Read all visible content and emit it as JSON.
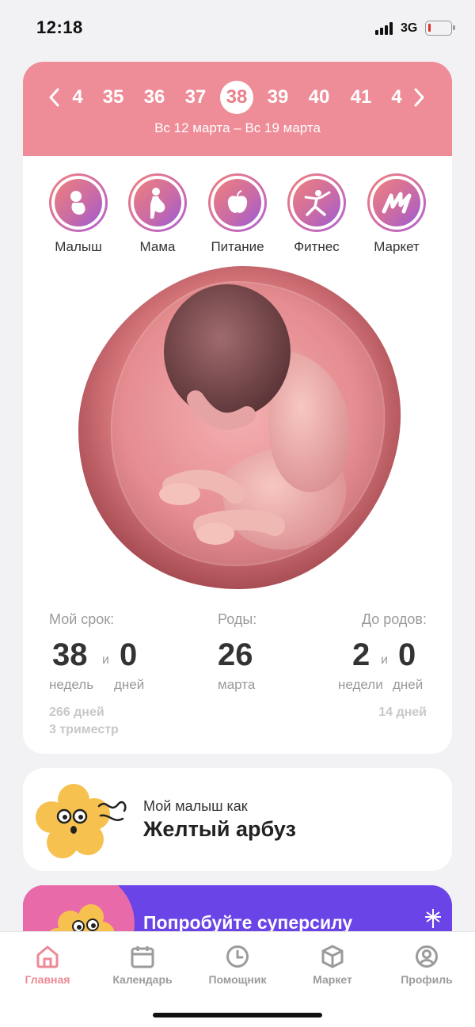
{
  "status": {
    "time": "12:18",
    "network": "3G"
  },
  "weeks": {
    "items": [
      "4",
      "35",
      "36",
      "37",
      "38",
      "39",
      "40",
      "41",
      "4"
    ],
    "active": "38",
    "range": "Вс 12 марта – Вс 19 марта",
    "prev_icon": "chevron-left-icon",
    "next_icon": "chevron-right-icon"
  },
  "categories": [
    {
      "label": "Малыш",
      "icon": "baby-icon"
    },
    {
      "label": "Мама",
      "icon": "pregnant-woman-icon"
    },
    {
      "label": "Питание",
      "icon": "apple-icon"
    },
    {
      "label": "Фитнес",
      "icon": "yoga-icon"
    },
    {
      "label": "Маркет",
      "icon": "market-logo-icon"
    }
  ],
  "term": {
    "my_term_label": "Мой срок:",
    "weeks_value": "38",
    "and": "и",
    "days_value": "0",
    "weeks_unit": "недель",
    "days_unit": "дней",
    "total_days": "266 дней",
    "trimester": "3 триместр",
    "birth_label": "Роды:",
    "birth_day": "26",
    "birth_month": "марта",
    "until_label": "До родов:",
    "until_weeks": "2",
    "until_days": "0",
    "until_weeks_unit": "недели",
    "until_days_unit": "дней",
    "until_total": "14 дней"
  },
  "fruit": {
    "caption": "Мой малыш как",
    "name": "Желтый арбуз"
  },
  "promo": {
    "text": "Попробуйте суперсилу"
  },
  "tabs": [
    {
      "label": "Главная",
      "icon": "home-icon",
      "active": true
    },
    {
      "label": "Календарь",
      "icon": "calendar-icon",
      "active": false
    },
    {
      "label": "Помощник",
      "icon": "clock-icon",
      "active": false
    },
    {
      "label": "Маркет",
      "icon": "box-icon",
      "active": false
    },
    {
      "label": "Профиль",
      "icon": "profile-icon",
      "active": false
    }
  ],
  "colors": {
    "header": "#ee8c97",
    "accent": "#ec8a95",
    "promo": "#6a44e6",
    "flower": "#f6c14f"
  }
}
